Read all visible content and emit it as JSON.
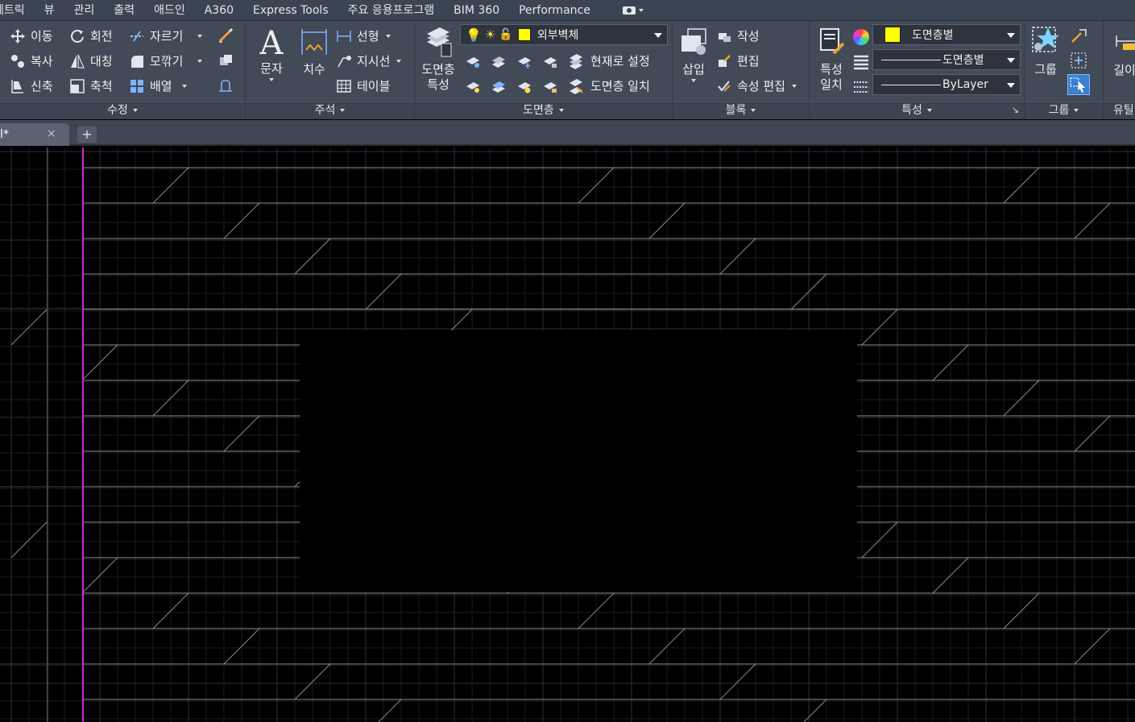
{
  "menu": {
    "tabs": [
      "메트릭",
      "뷰",
      "관리",
      "출력",
      "애드인",
      "A360",
      "Express Tools",
      "주요 응용프로그램",
      "BIM 360",
      "Performance"
    ]
  },
  "ribbon": {
    "modify": {
      "title": "수정",
      "move": "이동",
      "rotate": "회전",
      "trim": "자르기",
      "copy": "복사",
      "mirror": "대칭",
      "fillet": "모깎기",
      "stretch": "신축",
      "scale": "축척",
      "array": "배열"
    },
    "annotation": {
      "title": "주석",
      "text": "문자",
      "dimension": "치수",
      "linear": "선형",
      "leader": "지시선",
      "table": "테이블"
    },
    "layers": {
      "title": "도면층",
      "properties_line1": "도면층",
      "properties_line2": "특성",
      "current_layer": "외부벽체",
      "set_current": "현재로 설정",
      "match_layer": "도면층 일치"
    },
    "block": {
      "title": "블록",
      "insert": "삽입",
      "create": "작성",
      "edit": "편집",
      "edit_attributes": "속성 편집"
    },
    "properties": {
      "title": "특성",
      "match_line1": "특성",
      "match_line2": "일치",
      "color": "도면층별",
      "linetype": "도면층별",
      "lineweight": "ByLayer"
    },
    "groups": {
      "title": "그룹",
      "group": "그룹"
    },
    "utilities": {
      "title": "유틸",
      "measure": "길이"
    }
  },
  "file_tab": {
    "label": "l*",
    "close": "×",
    "new": "+"
  },
  "colors": {
    "ucs_axis": "#cc2ccc",
    "hatch": "#8a8a8a",
    "grid_minor": "#1a1d22",
    "grid_major": "#2a2f37",
    "layer_color": "#ffff00"
  }
}
